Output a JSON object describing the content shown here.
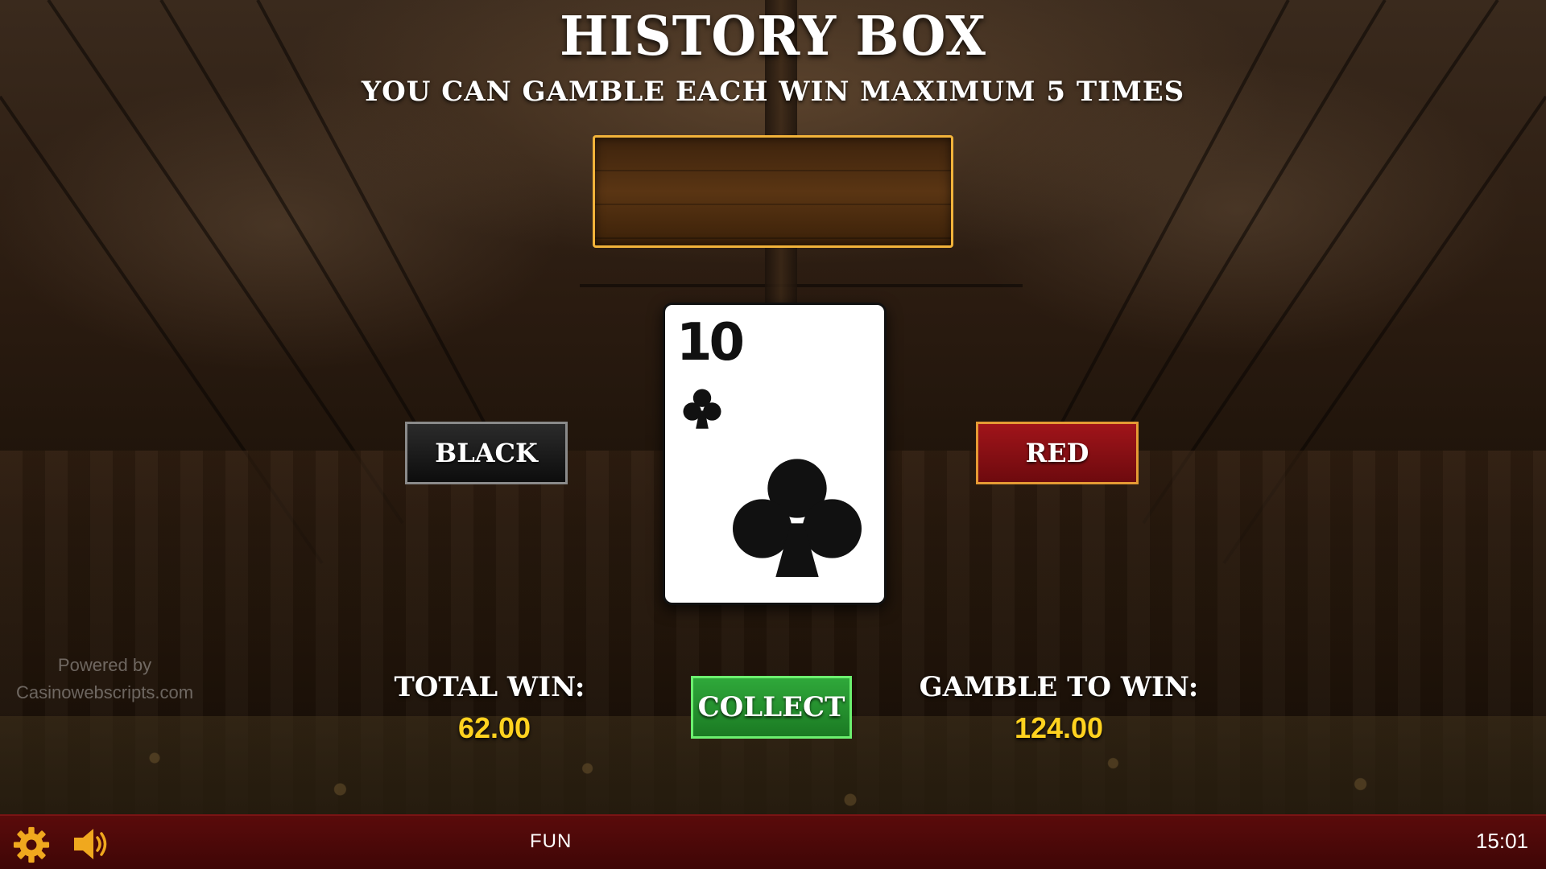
{
  "header": {
    "title": "HISTORY BOX",
    "subtitle": "YOU CAN GAMBLE EACH WIN MAXIMUM 5 TIMES"
  },
  "card": {
    "rank": "10",
    "suit": "clubs",
    "suit_icon": "club-icon",
    "color": "#111111"
  },
  "buttons": {
    "black_label": "BLACK",
    "red_label": "RED",
    "collect_label": "COLLECT"
  },
  "stats": {
    "total_win_label": "TOTAL WIN:",
    "total_win_value": "62.00",
    "gamble_to_win_label": "GAMBLE TO WIN:",
    "gamble_to_win_value": "124.00"
  },
  "watermark": {
    "line1": "Powered by",
    "line2": "Casinowebscripts.com"
  },
  "bottom_bar": {
    "settings_icon": "gear-icon",
    "sound_icon": "speaker-icon",
    "mode": "FUN",
    "time": "15:01"
  },
  "colors": {
    "accent_gold": "#f2b33a",
    "value_yellow": "#ffd21f",
    "red_button": "#a0141a",
    "collect_green": "#2fa83a",
    "bar_red": "#5a0b0b"
  }
}
